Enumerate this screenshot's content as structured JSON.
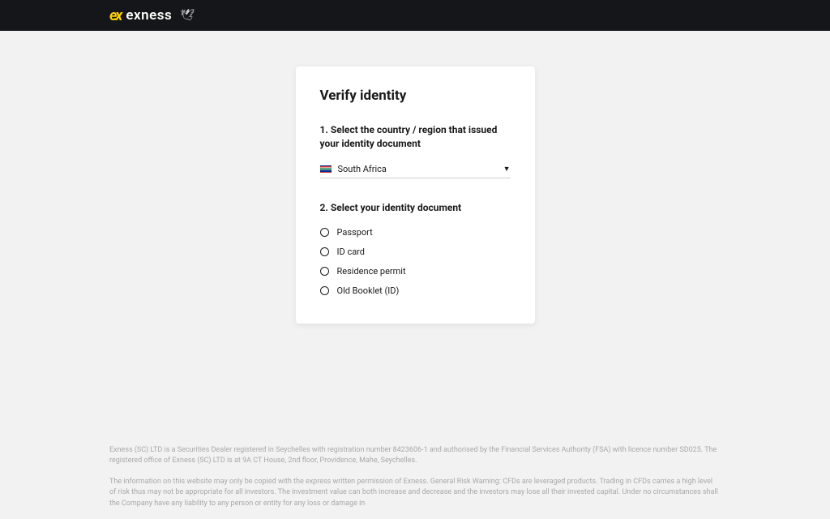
{
  "header": {
    "brand": "exness"
  },
  "card": {
    "title": "Verify identity",
    "step1_label": "1. Select the country / region that issued your identity document",
    "country_selected": "South Africa",
    "step2_label": "2. Select your identity document",
    "documents": [
      {
        "label": "Passport"
      },
      {
        "label": "ID card"
      },
      {
        "label": "Residence permit"
      },
      {
        "label": "Old Booklet (ID)"
      }
    ]
  },
  "footer": {
    "p1": "Exness (SC) LTD is a Securities Dealer registered in Seychelles with registration number 8423606-1 and authorised by the Financial Services Authority (FSA) with licence number SD025. The registered office of Exness (SC) LTD is at 9A CT House, 2nd floor, Providence, Mahe, Seychelles.",
    "p2": "The information on this website may only be copied with the express written permission of Exness. General Risk Warning: CFDs are leveraged products. Trading in CFDs carries a high level of risk thus may not be appropriate for all investors. The investment value can both increase and decrease and the investors may lose all their invested capital. Under no circumstances shall the Company have any liability to any person or entity for any loss or damage in"
  }
}
